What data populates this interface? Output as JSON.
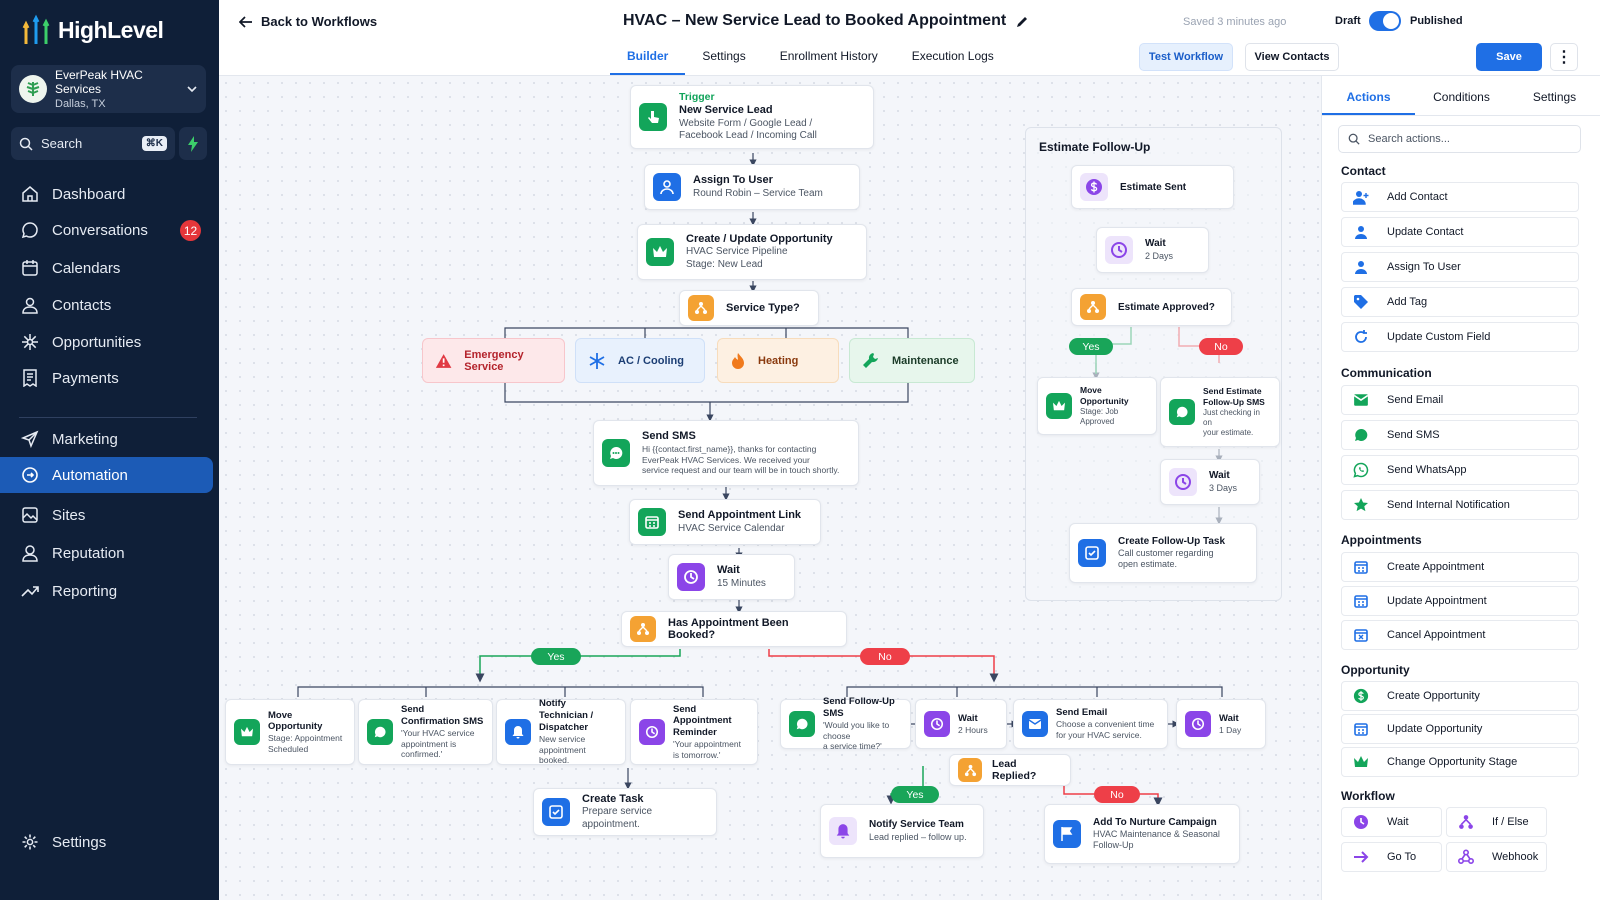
{
  "brand": {
    "name": "HighLevel"
  },
  "account": {
    "name": "EverPeak HVAC Services",
    "location": "Dallas, TX"
  },
  "search": {
    "label": "Search",
    "shortcut": "⌘K"
  },
  "nav": [
    {
      "label": "Dashboard",
      "icon": "home-icon"
    },
    {
      "label": "Conversations",
      "icon": "chat-icon",
      "badge": "12"
    },
    {
      "label": "Calendars",
      "icon": "calendar-icon"
    },
    {
      "label": "Contacts",
      "icon": "person-icon"
    },
    {
      "label": "Opportunities",
      "icon": "sparkle-icon"
    },
    {
      "label": "Payments",
      "icon": "receipt-icon"
    },
    {
      "label": "Marketing",
      "icon": "send-icon"
    },
    {
      "label": "Automation",
      "icon": "automation-icon",
      "active": true
    },
    {
      "label": "Sites",
      "icon": "sites-icon"
    },
    {
      "label": "Reputation",
      "icon": "reputation-icon"
    },
    {
      "label": "Reporting",
      "icon": "trend-icon"
    },
    {
      "label": "Settings",
      "icon": "gear-icon"
    }
  ],
  "header": {
    "back": "Back to Workflows",
    "title": "HVAC – New Service Lead to Booked Appointment",
    "saved": "Saved 3 minutes ago",
    "draft": "Draft",
    "published": "Published",
    "tabs": [
      "Builder",
      "Settings",
      "Enrollment History",
      "Execution Logs"
    ],
    "test": "Test Workflow",
    "view_contacts": "View Contacts",
    "save": "Save",
    "more": "⋮"
  },
  "flow": {
    "trigger": {
      "tag": "Trigger",
      "title": "New Service Lead",
      "desc1": "Website Form / Google Lead /",
      "desc2": "Facebook Lead / Incoming Call"
    },
    "assign": {
      "title": "Assign To User",
      "desc": "Round Robin – Service Team"
    },
    "opportunity": {
      "title": "Create / Update Opportunity",
      "desc1": "HVAC Service Pipeline",
      "desc2": "Stage: New Lead"
    },
    "service_type": {
      "title": "Service Type?"
    },
    "categories": [
      "Emergency Service",
      "AC / Cooling",
      "Heating",
      "Maintenance"
    ],
    "sms": {
      "title": "Send SMS",
      "desc1": "Hi {{contact.first_name}}, thanks for contacting",
      "desc2": "EverPeak HVAC Services. We received your",
      "desc3": "service request and our team will be in touch shortly."
    },
    "appt_link": {
      "title": "Send Appointment Link",
      "desc": "HVAC Service Calendar"
    },
    "wait15": {
      "title": "Wait",
      "desc": "15 Minutes"
    },
    "booked": {
      "title": "Has Appointment Been Booked?"
    },
    "yes": "Yes",
    "no": "No",
    "yes_branch": [
      {
        "title": "Move Opportunity",
        "desc1": "Stage: Appointment",
        "desc2": "Scheduled"
      },
      {
        "title": "Send Confirmation SMS",
        "desc1": "'Your HVAC service",
        "desc2": "appointment is confirmed.'"
      },
      {
        "title1": "Notify Technician /",
        "title2": "Dispatcher",
        "desc1": "New service appointment",
        "desc2": "booked."
      },
      {
        "title1": "Send Appointment",
        "title2": "Reminder",
        "desc1": "'Your appointment",
        "desc2": "is tomorrow.'"
      }
    ],
    "create_task": {
      "title": "Create Task",
      "desc": "Prepare service appointment."
    },
    "no_branch": [
      {
        "title": "Send Follow-Up SMS",
        "desc1": "'Would you like to choose",
        "desc2": "a service time?'"
      },
      {
        "title": "Wait",
        "desc": "2 Hours"
      },
      {
        "title": "Send Email",
        "desc1": "Choose a convenient time",
        "desc2": "for your HVAC service."
      },
      {
        "title": "Wait",
        "desc": "1 Day"
      }
    ],
    "replied": {
      "title": "Lead Replied?"
    },
    "notify_team": {
      "title": "Notify Service Team",
      "desc": "Lead replied – follow up."
    },
    "nurture": {
      "title": "Add To Nurture Campaign",
      "desc1": "HVAC Maintenance & Seasonal",
      "desc2": "Follow-Up"
    }
  },
  "estimate": {
    "title": "Estimate Follow-Up",
    "sent": "Estimate Sent",
    "wait1": {
      "title": "Wait",
      "desc": "2 Days"
    },
    "approved": "Estimate Approved?",
    "move": {
      "title": "Move Opportunity",
      "desc": "Stage: Job Approved"
    },
    "sms": {
      "title1": "Send Estimate",
      "title2": "Follow-Up SMS",
      "desc1": "Just checking in on",
      "desc2": "your estimate."
    },
    "wait2": {
      "title": "Wait",
      "desc": "3 Days"
    },
    "task": {
      "title": "Create Follow-Up Task",
      "desc1": "Call customer regarding",
      "desc2": "open estimate."
    }
  },
  "panel": {
    "tabs": [
      "Actions",
      "Conditions",
      "Settings"
    ],
    "search_placeholder": "Search actions...",
    "sections": [
      {
        "title": "Contact",
        "items": [
          "Add Contact",
          "Update Contact",
          "Assign To User",
          "Add Tag",
          "Update Custom Field"
        ]
      },
      {
        "title": "Communication",
        "items": [
          "Send Email",
          "Send SMS",
          "Send WhatsApp",
          "Send Internal Notification"
        ]
      },
      {
        "title": "Appointments",
        "items": [
          "Create Appointment",
          "Update Appointment",
          "Cancel Appointment"
        ]
      },
      {
        "title": "Opportunity",
        "items": [
          "Create Opportunity",
          "Update Opportunity",
          "Change Opportunity Stage"
        ]
      },
      {
        "title": "Workflow",
        "items": [
          "Wait",
          "If / Else",
          "Go To",
          "Webhook"
        ]
      }
    ]
  },
  "colors": {
    "accent": "#1f6fe5",
    "sidebar": "#0f1f38",
    "green": "#13a55a",
    "red": "#ee3f48",
    "orange": "#f4a233",
    "purple": "#8b45e8"
  }
}
